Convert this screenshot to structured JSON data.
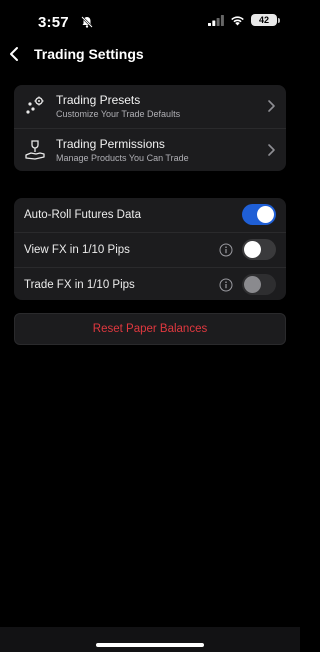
{
  "status_bar": {
    "time": "3:57",
    "battery": "42"
  },
  "header": {
    "title": "Trading Settings"
  },
  "links": [
    {
      "title": "Trading Presets",
      "subtitle": "Customize Your Trade Defaults",
      "icon": "presets-icon"
    },
    {
      "title": "Trading Permissions",
      "subtitle": "Manage Products You Can Trade",
      "icon": "permissions-icon"
    }
  ],
  "toggles": [
    {
      "label": "Auto-Roll Futures Data",
      "state": "on",
      "info": false
    },
    {
      "label": "View FX in 1/10 Pips",
      "state": "off",
      "info": true
    },
    {
      "label": "Trade FX in 1/10 Pips",
      "state": "disabled",
      "info": true
    }
  ],
  "reset_button": {
    "label": "Reset Paper Balances"
  },
  "colors": {
    "background": "#000000",
    "card": "#1c1c1e",
    "accent": "#1f5fd6",
    "danger": "#e0383f"
  }
}
